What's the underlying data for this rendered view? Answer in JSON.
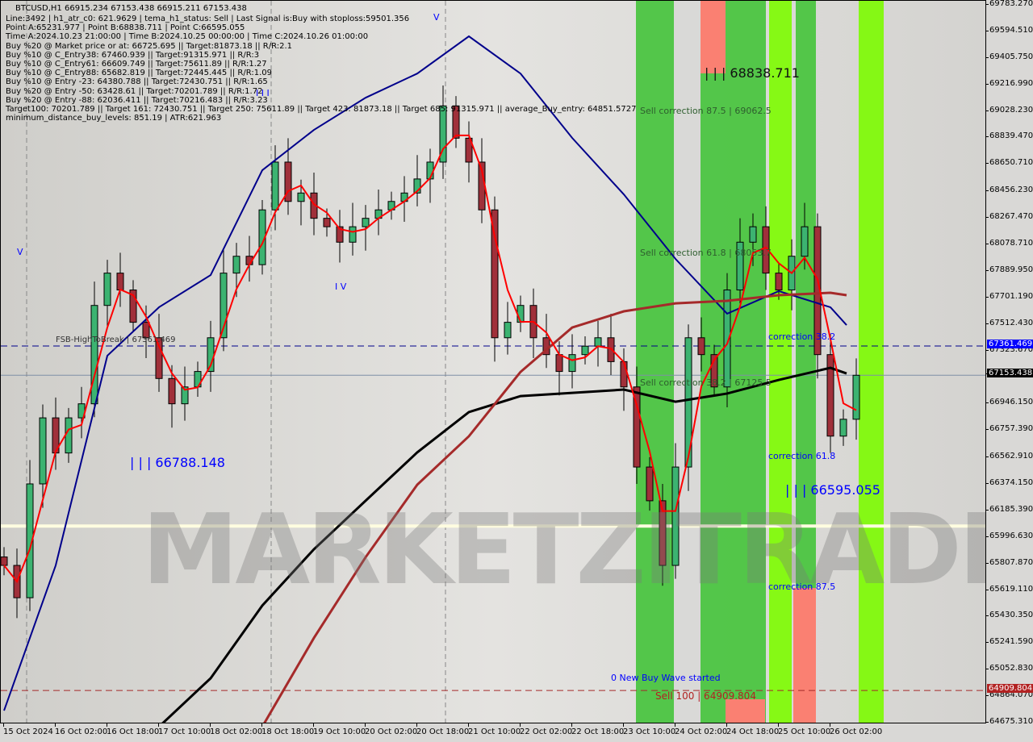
{
  "header": {
    "title": "BTCUSD,H1  66915.234 67153.438 66915.211 67153.438",
    "lines": [
      "Line:3492 | h1_atr_c0: 621.9629 | tema_h1_status: Sell | Last Signal is:Buy with stoploss:59501.356",
      "Point A:65231.977 | Point B:68838.711 | Point C:66595.055",
      "Time A:2024.10.23 21:00:00 | Time B:2024.10.25 00:00:00 | Time C:2024.10.26 01:00:00",
      "Buy %20 @ Market price or at: 66725.695 || Target:81873.18 || R/R:2.1",
      "Buy %10 @ C_Entry38: 67460.939 || Target:91315.971 || R/R:3",
      "Buy %10 @ C_Entry61: 66609.749 || Target:75611.89 || R/R:1.27",
      "Buy %10 @ C_Entry88: 65682.819 || Target:72445.445 || R/R:1.09",
      "Buy %10 @ Entry -23: 64380.788 || Target:72430.751 || R/R:1.65",
      "Buy %20 @ Entry -50: 63428.61 || Target:70201.789 || R/R:1.72",
      "Buy %20 @ Entry -88: 62036.411 || Target:70216.483 || R/R:3.23",
      "Target100: 70201.789 || Target 161: 72430.751 || Target 250: 75611.89 || Target 423: 81873.18 || Target 685: 91315.971 || average_Buy_entry: 64851.5727",
      "minimum_distance_buy_levels: 851.19 | ATR:621.963"
    ]
  },
  "annotations": {
    "point_b": "| | | 68838.711",
    "point_a_label": "| | | 66788.148",
    "point_c": "| | | 66595.055",
    "sell_875": "Sell correction 87.5 | 69062.5",
    "sell_618": "Sell correction 61.8 | 68053.7",
    "sell_382": "Sell correction 38.2 | 67125.5",
    "corr_382": "correction 38.2",
    "corr_618": "correction 61.8",
    "corr_875": "correction 87.5",
    "fsb": "FSB-HighToBreak | 67361.469",
    "new_wave": "0 New Buy Wave started",
    "sell100": "Sell 100 | 64909.804",
    "wave_v1": "V",
    "wave_v2": "V",
    "wave_iii": "I I I",
    "wave_iv": "I V",
    "watermark": "MARKETZITRADE"
  },
  "chart_data": {
    "type": "candlestick",
    "symbol": "BTCUSD",
    "timeframe": "H1",
    "ylim": [
      64675.31,
      69783.27
    ],
    "y_ticks": [
      "69783.270",
      "69594.510",
      "69405.750",
      "69216.990",
      "69028.230",
      "68839.470",
      "68650.710",
      "68456.230",
      "68267.470",
      "68078.710",
      "67889.950",
      "67701.190",
      "67512.430",
      "67323.670",
      "67153.438",
      "66946.150",
      "66757.390",
      "66562.910",
      "66374.150",
      "66185.390",
      "65996.630",
      "65807.870",
      "65619.110",
      "65430.350",
      "65241.590",
      "65052.830",
      "64864.070",
      "64675.310"
    ],
    "x_ticks": [
      "15 Oct 2024",
      "16 Oct 02:00",
      "16 Oct 18:00",
      "17 Oct 10:00",
      "18 Oct 02:00",
      "18 Oct 18:00",
      "19 Oct 10:00",
      "20 Oct 02:00",
      "20 Oct 18:00",
      "21 Oct 10:00",
      "22 Oct 02:00",
      "22 Oct 18:00",
      "23 Oct 10:00",
      "24 Oct 02:00",
      "24 Oct 18:00",
      "25 Oct 10:00",
      "26 Oct 02:00"
    ],
    "close_series": {
      "start": "15 Oct 10:00",
      "interval_hours": 4,
      "values": [
        65800,
        65570,
        66380,
        66850,
        66600,
        66850,
        66950,
        67650,
        67880,
        67760,
        67530,
        67420,
        67130,
        66950,
        67070,
        67180,
        67420,
        67880,
        68000,
        67940,
        68330,
        68670,
        68390,
        68450,
        68270,
        68210,
        68100,
        68210,
        68270,
        68330,
        68390,
        68450,
        68550,
        68670,
        69070,
        68840,
        68670,
        68330,
        67420,
        67530,
        67650,
        67420,
        67300,
        67180,
        67300,
        67360,
        67420,
        67250,
        67070,
        66500,
        66260,
        65800,
        66500,
        67420,
        67300,
        67070,
        67760,
        68100,
        68210,
        67880,
        67760,
        68000,
        68210,
        67300,
        66720,
        66840,
        67153
      ]
    },
    "moving_averages": [
      {
        "color": "#00008b",
        "points": [
          [
            "15 Oct 2024",
            64767
          ],
          [
            "16 Oct 02:00",
            65800
          ],
          [
            "16 Oct 18:00",
            67292
          ],
          [
            "17 Oct 10:00",
            67637
          ],
          [
            "18 Oct 02:00",
            67866
          ],
          [
            "18 Oct 18:00",
            68612
          ],
          [
            "19 Oct 10:00",
            68899
          ],
          [
            "20 Oct 02:00",
            69128
          ],
          [
            "20 Oct 18:00",
            69300
          ],
          [
            "21 Oct 10:00",
            69565
          ],
          [
            "22 Oct 02:00",
            69300
          ],
          [
            "22 Oct 18:00",
            68842
          ],
          [
            "23 Oct 10:00",
            68440
          ],
          [
            "24 Oct 02:00",
            67981
          ],
          [
            "24 Oct 18:00",
            67591
          ],
          [
            "25 Oct 10:00",
            67752
          ],
          [
            "26 Oct 02:00",
            67637
          ],
          [
            "26 Oct 07:00",
            67510
          ]
        ]
      },
      {
        "color": "#000000",
        "points": [
          [
            "17 Oct 10:00",
            64652
          ],
          [
            "18 Oct 02:00",
            64997
          ],
          [
            "18 Oct 18:00",
            65514
          ],
          [
            "19 Oct 10:00",
            65915
          ],
          [
            "20 Oct 02:00",
            66260
          ],
          [
            "20 Oct 18:00",
            66604
          ],
          [
            "21 Oct 10:00",
            66891
          ],
          [
            "22 Oct 02:00",
            67005
          ],
          [
            "22 Oct 18:00",
            67028
          ],
          [
            "23 Oct 10:00",
            67051
          ],
          [
            "24 Oct 02:00",
            66965
          ],
          [
            "24 Oct 18:00",
            67023
          ],
          [
            "25 Oct 10:00",
            67120
          ],
          [
            "26 Oct 02:00",
            67206
          ],
          [
            "26 Oct 07:00",
            67166
          ]
        ]
      },
      {
        "color": "#a52a2a",
        "points": [
          [
            "18 Oct 18:00",
            64652
          ],
          [
            "19 Oct 10:00",
            65284
          ],
          [
            "20 Oct 02:00",
            65858
          ],
          [
            "20 Oct 18:00",
            66374
          ],
          [
            "21 Oct 10:00",
            66719
          ],
          [
            "22 Oct 02:00",
            67177
          ],
          [
            "22 Oct 18:00",
            67493
          ],
          [
            "23 Oct 10:00",
            67608
          ],
          [
            "24 Oct 02:00",
            67665
          ],
          [
            "24 Oct 18:00",
            67683
          ],
          [
            "25 Oct 10:00",
            67723
          ],
          [
            "26 Oct 02:00",
            67740
          ],
          [
            "26 Oct 07:00",
            67723
          ]
        ]
      }
    ],
    "levels": [
      {
        "price": 67361.469,
        "label": "67361.469",
        "style": "dashed",
        "color": "#00008b",
        "badge_bg": "#0000ff"
      },
      {
        "price": 67153.438,
        "label": "67153.438",
        "style": "solid",
        "color": "#7f8fa6",
        "badge_bg": "#000000"
      },
      {
        "price": 66080,
        "style": "thick",
        "color": "#fffde0"
      },
      {
        "price": 64909.804,
        "label": "64909.804",
        "style": "dashed",
        "color": "#a52a2a",
        "badge_bg": "#b22222"
      }
    ],
    "colors": {
      "bull": "#3cb371",
      "bear": "#a0303a",
      "fast_ma": "#ff0000",
      "band_green": "#44c33a",
      "band_lime": "#7cfc00",
      "band_salmon": "#fa8072"
    }
  }
}
